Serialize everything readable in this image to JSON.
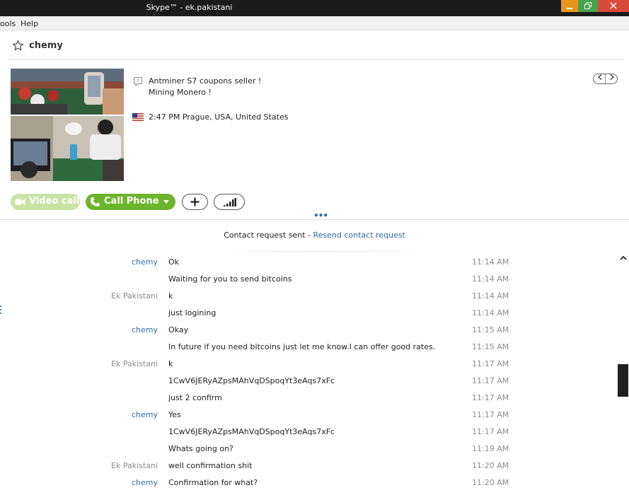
{
  "window": {
    "title": "Skype™ - ek.pakistani"
  },
  "menu": {
    "tools": "ools",
    "help": "Help"
  },
  "header": {
    "contact_name": "chemy"
  },
  "profile": {
    "mood_line1": "Antminer S7 coupons seller !",
    "mood_line2": "Mining Monero !",
    "local_time_location": "2:47 PM Prague, USA, United States"
  },
  "actions": {
    "video_call": "Video call",
    "call_phone": "Call Phone"
  },
  "handle_dots": "•••",
  "contact_request": {
    "text": "Contact request sent - ",
    "link": "Resend contact request"
  },
  "messages": [
    {
      "sender": "chemy",
      "text": "Ok",
      "time": "11:14 AM"
    },
    {
      "sender": "",
      "text": "Waiting for you to send bitcoins",
      "time": "11:14 AM"
    },
    {
      "sender": "Ek Pakistani",
      "text": "k",
      "time": "11:14 AM"
    },
    {
      "sender": "",
      "text": "just logining",
      "time": "11:14 AM"
    },
    {
      "sender": "chemy",
      "text": "Okay",
      "time": "11:15 AM"
    },
    {
      "sender": "",
      "text": "In future if you need bitcoins just let me know.I can offer good rates.",
      "time": "11:15 AM"
    },
    {
      "sender": "Ek Pakistani",
      "text": "k",
      "time": "11:17 AM"
    },
    {
      "sender": "",
      "text": "1CwV6JERyAZpsMAhVqDSpoqYt3eAqs7xFc",
      "time": "11:17 AM"
    },
    {
      "sender": "",
      "text": "just 2 confirm",
      "time": "11:17 AM"
    },
    {
      "sender": "chemy",
      "text": "Yes",
      "time": "11:17 AM"
    },
    {
      "sender": "",
      "text": "1CwV6JERyAZpsMAhVqDSpoqYt3eAqs7xFc",
      "time": "11:17 AM"
    },
    {
      "sender": "",
      "text": "Whats going on?",
      "time": "11:19 AM"
    },
    {
      "sender": "Ek Pakistani",
      "text": "well confirmation shit",
      "time": "11:20 AM"
    },
    {
      "sender": "chemy",
      "text": "Confirmation for what?",
      "time": "11:20 AM"
    }
  ],
  "colors": {
    "link_blue": "#2b6ea5",
    "call_green": "#6cb52d",
    "video_green_disabled": "#c8e3a4",
    "titlebar": "#1b1b1b"
  }
}
